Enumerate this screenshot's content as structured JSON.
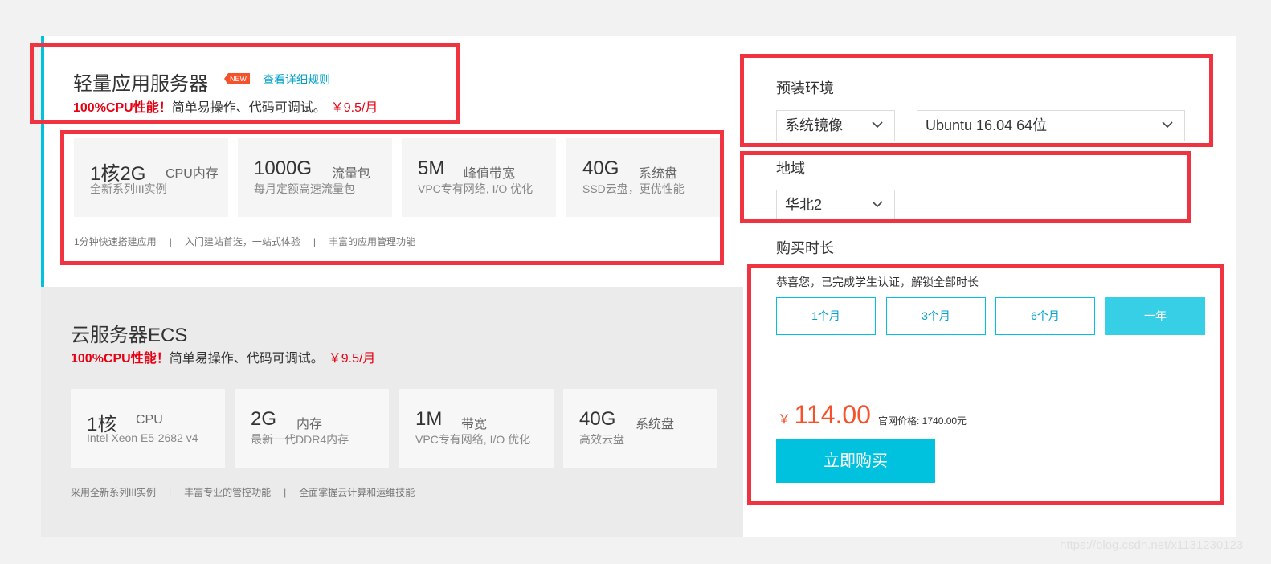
{
  "lightweight": {
    "title": "轻量应用服务器",
    "badge": "NEW",
    "rules_link": "查看详细规则",
    "promo_highlight": "100%CPU性能！",
    "promo_text": "简单易操作、代码可调试。",
    "promo_price": "￥9.5/月",
    "specs": [
      {
        "value": "1核2G",
        "unit": "CPU内存",
        "desc": "全新系列III实例"
      },
      {
        "value": "1000G",
        "unit": "流量包",
        "desc": "每月定额高速流量包"
      },
      {
        "value": "5M",
        "unit": "峰值带宽",
        "desc": "VPC专有网络, I/O 优化"
      },
      {
        "value": "40G",
        "unit": "系统盘",
        "desc": "SSD云盘，更优性能"
      }
    ],
    "features": [
      "1分钟快速搭建应用",
      "入门建站首选，一站式体验",
      "丰富的应用管理功能"
    ],
    "separator": "|"
  },
  "ecs": {
    "title": "云服务器ECS",
    "promo_highlight": "100%CPU性能！",
    "promo_text": "简单易操作、代码可调试。",
    "promo_price": "￥9.5/月",
    "specs": [
      {
        "value": "1核",
        "unit": "CPU",
        "desc": "Intel Xeon E5-2682 v4"
      },
      {
        "value": "2G",
        "unit": "内存",
        "desc": "最新一代DDR4内存"
      },
      {
        "value": "1M",
        "unit": "带宽",
        "desc": "VPC专有网络, I/O 优化"
      },
      {
        "value": "40G",
        "unit": "系统盘",
        "desc": "高效云盘"
      }
    ],
    "features": [
      "采用全新系列III实例",
      "丰富专业的管控功能",
      "全面掌握云计算和运维技能"
    ],
    "separator": "|"
  },
  "config": {
    "env_label": "预装环境",
    "image_type": "系统镜像",
    "os": "Ubuntu 16.04 64位",
    "region_label": "地域",
    "region": "华北2",
    "duration_label": "购买时长",
    "student_note": "恭喜您，已完成学生认证，解锁全部时长",
    "durations": [
      "1个月",
      "3个月",
      "6个月",
      "一年"
    ],
    "selected_duration": "一年",
    "currency": "￥",
    "price": "114.00",
    "official_price": "官网价格: 1740.00元",
    "buy_label": "立即购买"
  },
  "watermark": "https://blog.csdn.net/x1131230123",
  "colors": {
    "accent": "#00c1de",
    "price": "#f5512b",
    "promo": "#e60012",
    "annotation": "#ef3340"
  }
}
